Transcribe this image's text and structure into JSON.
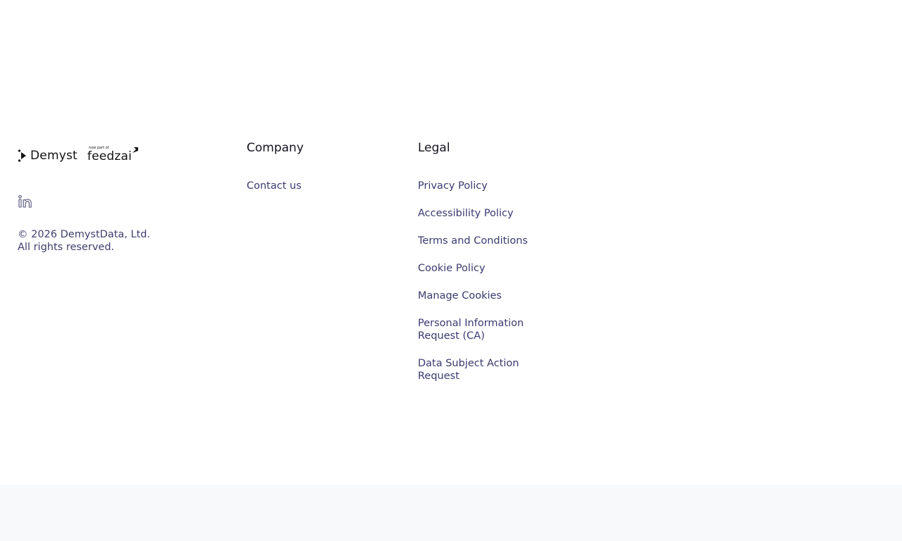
{
  "brand": {
    "demyst_name": "Demyst",
    "feedzai_tagline": "now part of",
    "feedzai_name": "feedzai",
    "social_icon": "linkedin-icon",
    "copyright_line1": "© 2026 DemystData, Ltd.",
    "copyright_line2": "All rights reserved."
  },
  "company": {
    "title": "Company",
    "links": [
      {
        "label": "Contact us"
      }
    ]
  },
  "legal": {
    "title": "Legal",
    "links": [
      {
        "label": "Privacy Policy"
      },
      {
        "label": "Accessibility Policy"
      },
      {
        "label": "Terms and Conditions"
      },
      {
        "label": "Cookie Policy"
      },
      {
        "label": "Manage Cookies"
      },
      {
        "label": "Personal Information Request (CA)"
      },
      {
        "label": "Data Subject Action Request"
      }
    ]
  },
  "colors": {
    "link": "#3b3970",
    "heading": "#14131f",
    "icon": "#6b6b8f",
    "footer_band": "#f8f9fb"
  }
}
